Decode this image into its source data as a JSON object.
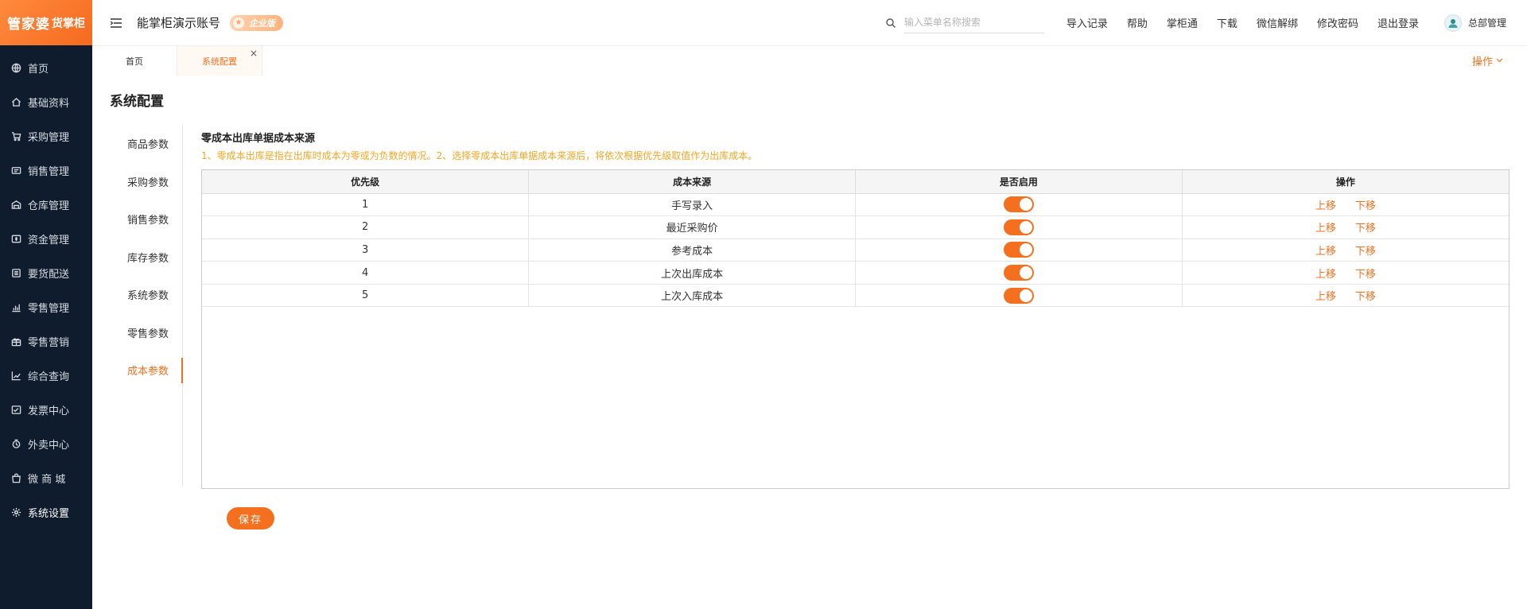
{
  "logo": {
    "main": "管家婆",
    "sub": "货掌柜"
  },
  "sidebar": {
    "items": [
      {
        "label": "首页",
        "icon": "globe-icon"
      },
      {
        "label": "基础资料",
        "icon": "home-icon"
      },
      {
        "label": "采购管理",
        "icon": "cart-icon"
      },
      {
        "label": "销售管理",
        "icon": "ticket-icon"
      },
      {
        "label": "仓库管理",
        "icon": "warehouse-icon"
      },
      {
        "label": "资金管理",
        "icon": "money-icon"
      },
      {
        "label": "要货配送",
        "icon": "list-icon"
      },
      {
        "label": "零售管理",
        "icon": "bar-chart-icon"
      },
      {
        "label": "零售营销",
        "icon": "gift-icon"
      },
      {
        "label": "综合查询",
        "icon": "chart-icon"
      },
      {
        "label": "发票中心",
        "icon": "invoice-icon"
      },
      {
        "label": "外卖中心",
        "icon": "delivery-icon"
      },
      {
        "label": "微 商 城",
        "icon": "shop-bag-icon"
      },
      {
        "label": "系统设置",
        "icon": "gear-icon"
      }
    ],
    "active_index": 13
  },
  "header": {
    "account_name": "能掌柜演示账号",
    "badge": "企业版",
    "search_placeholder": "输入菜单名称搜索",
    "links": [
      "导入记录",
      "帮助",
      "掌柜通",
      "下载",
      "微信解绑",
      "修改密码",
      "退出登录"
    ],
    "user_name": "总部管理"
  },
  "tabs": {
    "items": [
      {
        "label": "首页"
      },
      {
        "label": "系统配置"
      }
    ],
    "ops_label": "操作",
    "close_symbol": "×"
  },
  "page": {
    "title": "系统配置",
    "subnav": [
      "商品参数",
      "采购参数",
      "销售参数",
      "库存参数",
      "系统参数",
      "零售参数",
      "成本参数"
    ],
    "subnav_active": 6,
    "section_title": "零成本出库单据成本来源",
    "section_note": "1、零成本出库是指在出库时成本为零或为负数的情况。2、选择零成本出库单据成本来源后，将依次根据优先级取值作为出库成本。",
    "table": {
      "columns": [
        "优先级",
        "成本来源",
        "是否启用",
        "操作"
      ],
      "rows": [
        {
          "priority": "1",
          "source": "手写录入",
          "enabled": true,
          "up": "上移",
          "down": "下移"
        },
        {
          "priority": "2",
          "source": "最近采购价",
          "enabled": true,
          "up": "上移",
          "down": "下移"
        },
        {
          "priority": "3",
          "source": "参考成本",
          "enabled": true,
          "up": "上移",
          "down": "下移"
        },
        {
          "priority": "4",
          "source": "上次出库成本",
          "enabled": true,
          "up": "上移",
          "down": "下移"
        },
        {
          "priority": "5",
          "source": "上次入库成本",
          "enabled": true,
          "up": "上移",
          "down": "下移"
        }
      ]
    },
    "save_label": "保存"
  },
  "colors": {
    "accent": "#f5701e",
    "sidebar_bg": "#0f1c2d",
    "note": "#f6a623"
  }
}
